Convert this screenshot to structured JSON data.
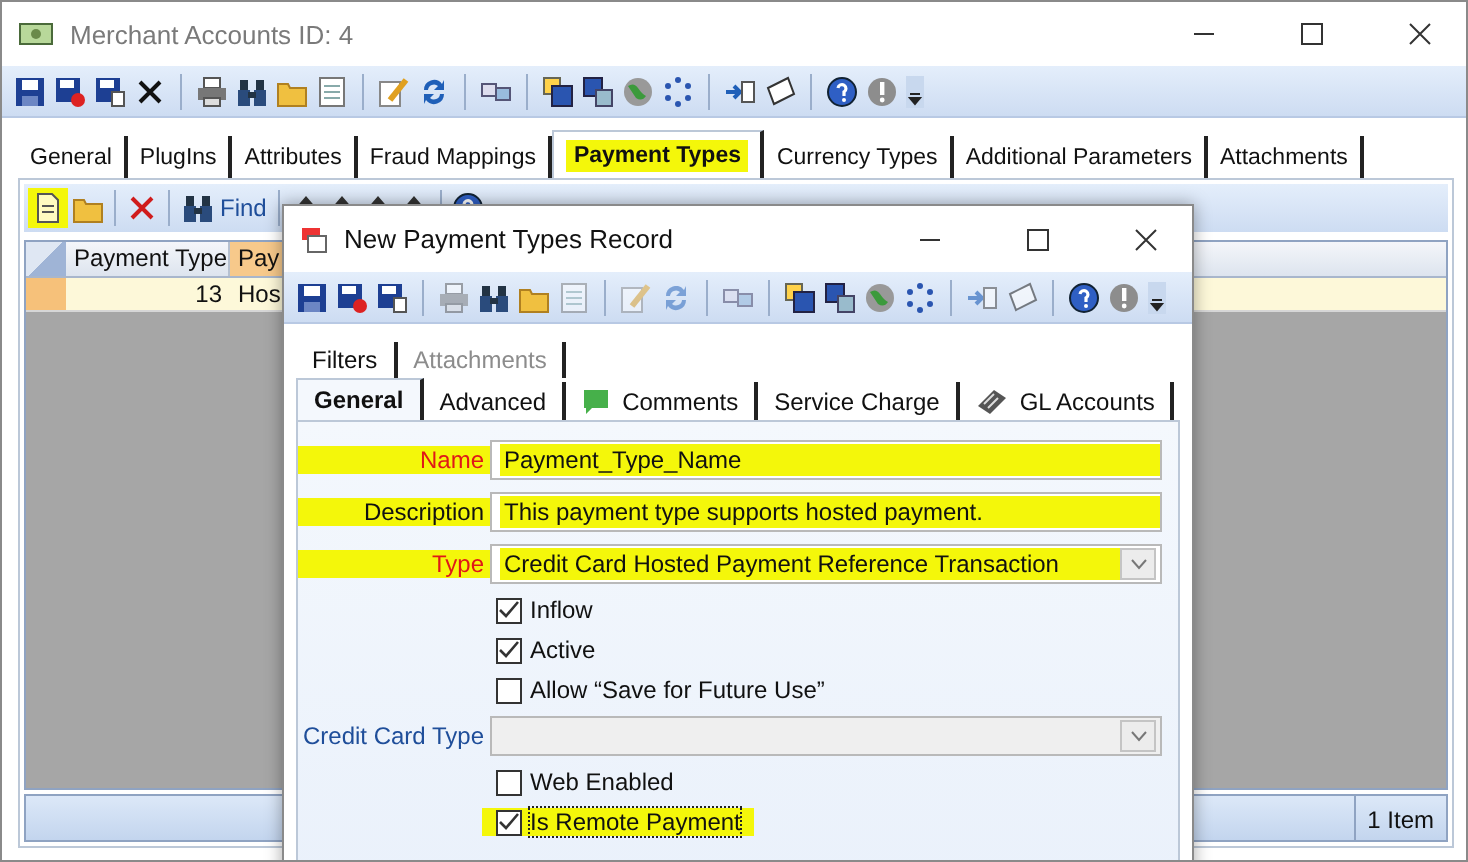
{
  "window": {
    "title": "Merchant Accounts ID: 4"
  },
  "tabs": [
    {
      "label": "General",
      "selected": false,
      "highlighted": false
    },
    {
      "label": "PlugIns",
      "selected": false,
      "highlighted": false
    },
    {
      "label": "Attributes",
      "selected": false,
      "highlighted": false
    },
    {
      "label": "Fraud Mappings",
      "selected": false,
      "highlighted": false
    },
    {
      "label": "Payment Types",
      "selected": true,
      "highlighted": true
    },
    {
      "label": "Currency Types",
      "selected": false,
      "highlighted": false
    },
    {
      "label": "Additional Parameters",
      "selected": false,
      "highlighted": false
    },
    {
      "label": "Attachments",
      "selected": false,
      "highlighted": false
    }
  ],
  "sub_toolbar": {
    "new_highlighted": true,
    "find_label": "Find"
  },
  "grid": {
    "columns": [
      {
        "label": "Payment Type",
        "sorted": false
      },
      {
        "label": "Pay",
        "sorted": true
      }
    ],
    "rows": [
      {
        "cells": [
          "13",
          "Hos"
        ],
        "selected": true
      }
    ]
  },
  "status_bar": {
    "count": "1 Item"
  },
  "dialog": {
    "title": "New Payment Types Record",
    "back_tabs": [
      {
        "label": "Filters",
        "disabled": false
      },
      {
        "label": "Attachments",
        "disabled": true
      }
    ],
    "tabs": [
      {
        "label": "General",
        "selected": true,
        "kind": "plain"
      },
      {
        "label": "Advanced",
        "selected": false,
        "kind": "plain"
      },
      {
        "label": "Comments",
        "selected": false,
        "kind": "speech"
      },
      {
        "label": "Service Charge",
        "selected": false,
        "kind": "plain"
      },
      {
        "label": "GL Accounts",
        "selected": false,
        "kind": "calculator"
      }
    ],
    "fields": [
      {
        "kind": "text",
        "label": "Name",
        "value": "Payment_Type_Name",
        "required": true,
        "disabled": false,
        "highlighted": true
      },
      {
        "kind": "text",
        "label": "Description",
        "value": "This payment type supports hosted payment.",
        "required": false,
        "disabled": false,
        "highlighted": true
      },
      {
        "kind": "select",
        "label": "Type",
        "value": "Credit Card Hosted Payment Reference Transaction",
        "required": true,
        "disabled": false,
        "highlighted": true
      },
      {
        "kind": "checkbox",
        "label": "Inflow",
        "checked": true,
        "highlighted": false,
        "focused": false
      },
      {
        "kind": "checkbox",
        "label": "Active",
        "checked": true,
        "highlighted": false,
        "focused": false
      },
      {
        "kind": "checkbox",
        "label": "Allow “Save for Future Use”",
        "checked": false,
        "highlighted": false,
        "focused": false
      },
      {
        "kind": "select",
        "label": "Credit Card Type",
        "required": false,
        "disabled": true,
        "highlighted": false
      },
      {
        "kind": "checkbox",
        "label": "Web Enabled",
        "checked": false,
        "highlighted": false,
        "focused": false
      },
      {
        "kind": "checkbox",
        "label": "Is Remote Payment",
        "checked": true,
        "highlighted": true,
        "focused": true
      }
    ]
  }
}
